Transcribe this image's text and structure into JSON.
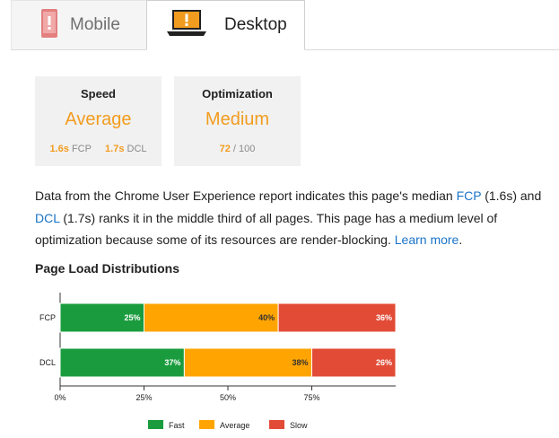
{
  "tabs": [
    {
      "label": "Mobile",
      "icon": "mobile-alert-icon",
      "active": false
    },
    {
      "label": "Desktop",
      "icon": "desktop-alert-icon",
      "active": true
    }
  ],
  "speed_card": {
    "title": "Speed",
    "rating": "Average",
    "fcp_value": "1.6s",
    "fcp_label": "FCP",
    "dcl_value": "1.7s",
    "dcl_label": "DCL"
  },
  "optimization_card": {
    "title": "Optimization",
    "rating": "Medium",
    "score": "72",
    "score_max": "/ 100"
  },
  "description": {
    "part1": "Data from the Chrome User Experience report indicates this page's median ",
    "fcp_link": "FCP",
    "part2": " (1.6s) and ",
    "dcl_link": "DCL",
    "part3": " (1.7s) ranks it in the middle third of all pages. This page has a medium level of optimization because some of its resources are render-blocking. ",
    "learn_more": "Learn more",
    "part4": "."
  },
  "section_title": "Page Load Distributions",
  "colors": {
    "fast": "#1a9c3e",
    "average": "#ffa400",
    "slow": "#e24b36",
    "accent_orange": "#f29c1f",
    "link": "#1a73c8"
  },
  "chart_data": {
    "type": "bar",
    "orientation": "horizontal-stacked",
    "categories": [
      "FCP",
      "DCL"
    ],
    "series": [
      {
        "name": "Fast",
        "values": [
          25,
          37
        ],
        "labels": [
          "25%",
          "37%"
        ]
      },
      {
        "name": "Average",
        "values": [
          40,
          38
        ],
        "labels": [
          "40%",
          "38%"
        ]
      },
      {
        "name": "Slow",
        "values": [
          36,
          26
        ],
        "labels": [
          "36%",
          "26%"
        ]
      }
    ],
    "xlim": [
      0,
      100
    ],
    "xticks": [
      "0%",
      "25%",
      "50%",
      "75%"
    ],
    "legend_position": "bottom"
  }
}
